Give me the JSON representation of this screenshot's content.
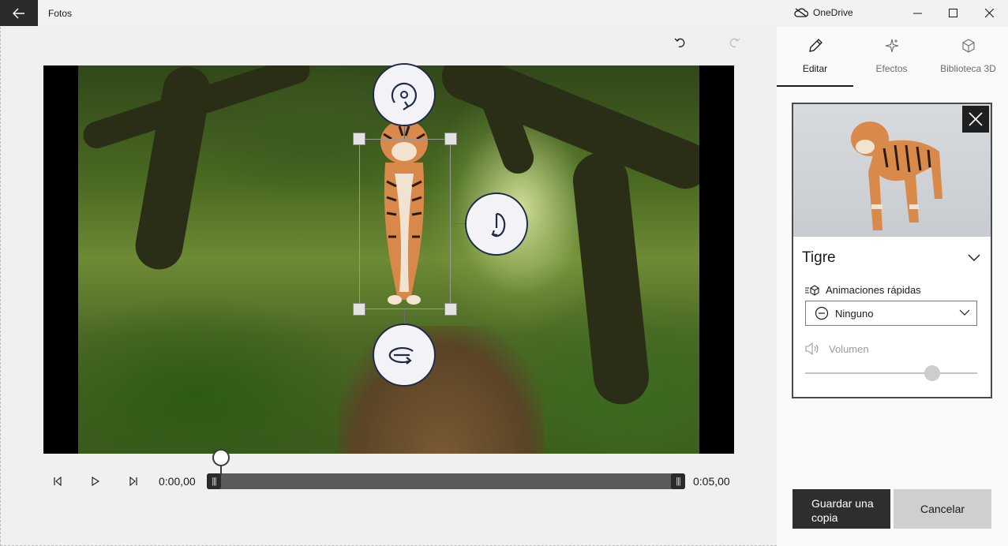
{
  "window": {
    "app_title": "Fotos",
    "onedrive_label": "OneDrive",
    "icons": [
      "back-arrow-icon",
      "cloud-offline-icon",
      "minimize-icon",
      "maximize-icon",
      "close-icon"
    ]
  },
  "toolbar": {
    "undo_icon": "undo-icon",
    "redo_icon": "redo-icon"
  },
  "playback": {
    "current_time": "0:00,00",
    "end_time": "0:05,00",
    "position_fraction": 0.0
  },
  "panel": {
    "tabs": [
      {
        "label": "Editar",
        "icon": "pencil-icon",
        "active": true
      },
      {
        "label": "Efectos",
        "icon": "sparkle-icon",
        "active": false
      },
      {
        "label": "Biblioteca 3D",
        "icon": "cube-icon",
        "active": false
      }
    ],
    "model": {
      "name": "Tigre",
      "quick_anim_label": "Animaciones rápidas",
      "quick_anim_value": "Ninguno",
      "volume_label": "Volumen",
      "volume_fraction": 0.73
    },
    "buttons": {
      "save": "Guardar una copia",
      "cancel": "Cancelar"
    }
  }
}
